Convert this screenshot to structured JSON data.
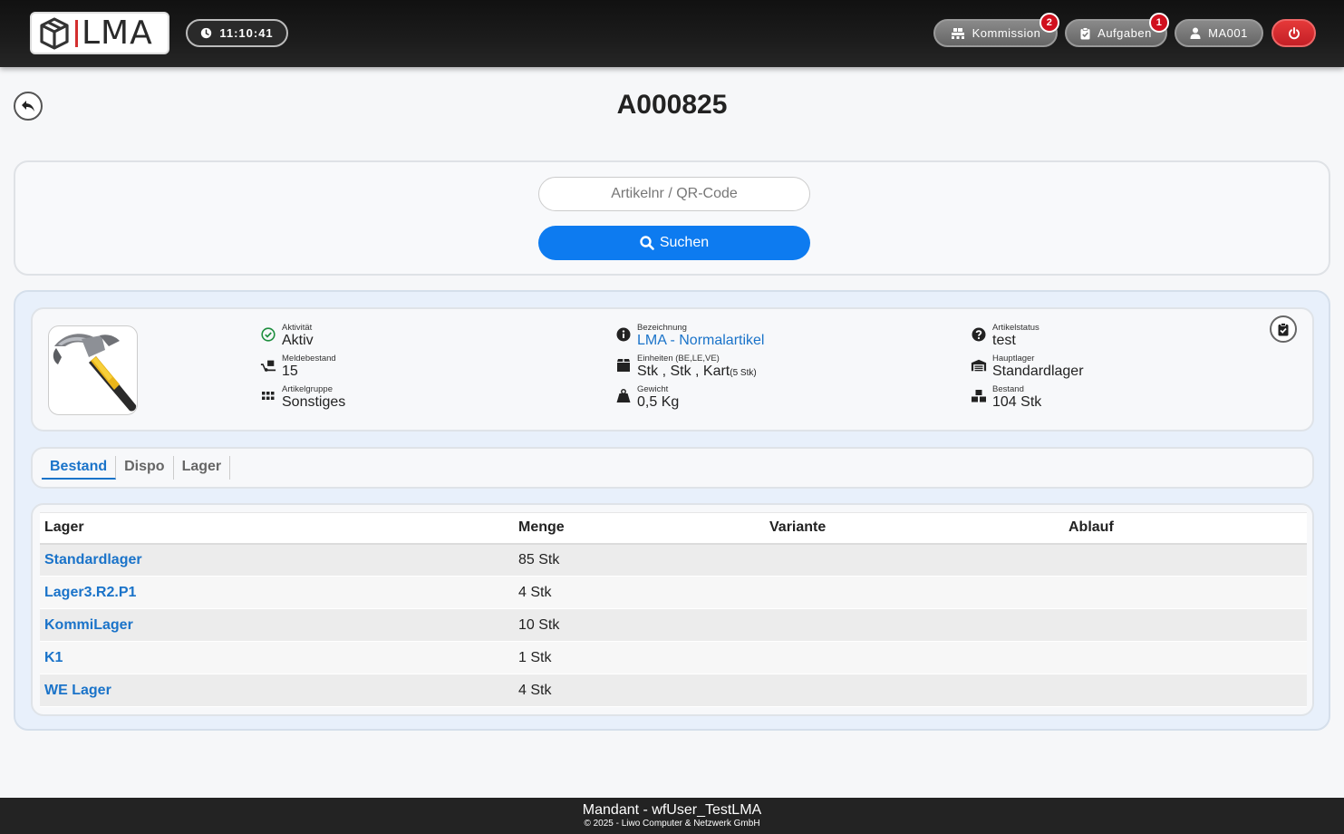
{
  "header": {
    "logo_text": "LMA",
    "clock": "11:10:41",
    "kommission": {
      "label": "Kommission",
      "badge": "2"
    },
    "aufgaben": {
      "label": "Aufgaben",
      "badge": "1"
    },
    "user": {
      "label": "MA001"
    },
    "colors": {
      "accent_red": "#d32f2f",
      "badge": "#d0101e"
    }
  },
  "page": {
    "title": "A000825"
  },
  "search": {
    "placeholder": "Artikelnr / QR-Code",
    "value": "",
    "button_label": "Suchen",
    "button_color": "#0d7bf0"
  },
  "article": {
    "aktivitaet": {
      "label": "Aktivität",
      "value": "Aktiv"
    },
    "meldebestand": {
      "label": "Meldebestand",
      "value": "15"
    },
    "artikelgruppe": {
      "label": "Artikelgruppe",
      "value": "Sonstiges"
    },
    "bezeichnung": {
      "label": "Bezeichnung",
      "value": "LMA - Normalartikel"
    },
    "einheiten": {
      "label": "Einheiten (BE,LE,VE)",
      "value": "Stk , Stk , Kart",
      "suffix": "(5 Stk)"
    },
    "gewicht": {
      "label": "Gewicht",
      "value": "0,5 Kg"
    },
    "artikelstatus": {
      "label": "Artikelstatus",
      "value": "test"
    },
    "hauptlager": {
      "label": "Hauptlager",
      "value": "Standardlager"
    },
    "bestand": {
      "label": "Bestand",
      "value": "104 Stk"
    },
    "image": "hammer"
  },
  "tabs": [
    {
      "label": "Bestand",
      "active": true
    },
    {
      "label": "Dispo",
      "active": false
    },
    {
      "label": "Lager",
      "active": false
    }
  ],
  "table": {
    "columns": [
      "Lager",
      "Menge",
      "Variante",
      "Ablauf"
    ],
    "rows": [
      {
        "lager": "Standardlager",
        "menge": "85 Stk",
        "variante": "",
        "ablauf": ""
      },
      {
        "lager": "Lager3.R2.P1",
        "menge": "4 Stk",
        "variante": "",
        "ablauf": ""
      },
      {
        "lager": "KommiLager",
        "menge": "10 Stk",
        "variante": "",
        "ablauf": ""
      },
      {
        "lager": "K1",
        "menge": "1 Stk",
        "variante": "",
        "ablauf": ""
      },
      {
        "lager": "WE Lager",
        "menge": "4 Stk",
        "variante": "",
        "ablauf": ""
      }
    ]
  },
  "footer": {
    "line1": "Mandant - wfUser_TestLMA",
    "line2": "© 2025 - Liwo Computer & Netzwerk GmbH"
  }
}
